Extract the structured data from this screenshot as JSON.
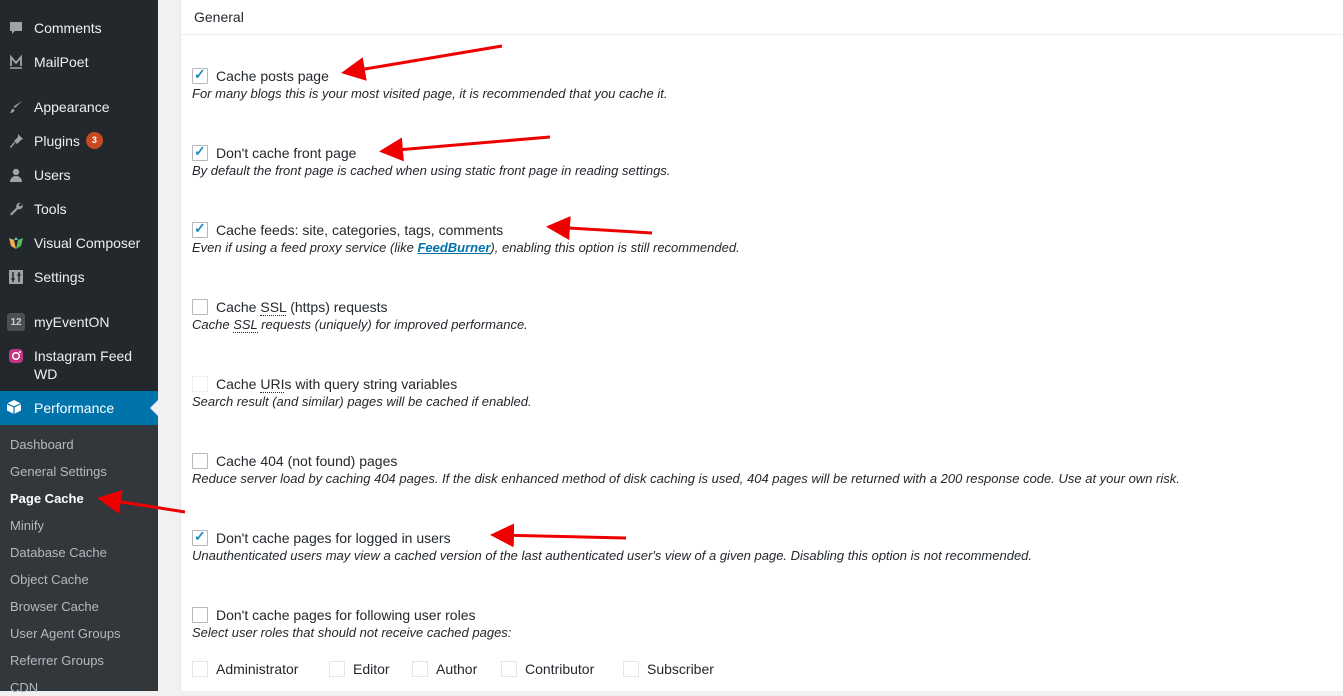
{
  "sidebar": {
    "items": [
      {
        "label": "Comments",
        "icon": "comment-icon"
      },
      {
        "label": "MailPoet",
        "icon": "mailpoet-icon"
      },
      {
        "label": "Appearance",
        "icon": "paintbrush-icon"
      },
      {
        "label": "Plugins",
        "icon": "plug-icon",
        "badge": "3"
      },
      {
        "label": "Users",
        "icon": "user-icon"
      },
      {
        "label": "Tools",
        "icon": "wrench-icon"
      },
      {
        "label": "Visual Composer",
        "icon": "visual-composer-icon"
      },
      {
        "label": "Settings",
        "icon": "settings-icon"
      },
      {
        "label": "myEventON",
        "icon": "calendar-icon",
        "icon_text": "12"
      },
      {
        "label": "Instagram Feed WD",
        "icon": "instagram-icon"
      }
    ],
    "active": {
      "label": "Performance",
      "icon": "performance-icon"
    },
    "submenu": [
      "Dashboard",
      "General Settings",
      "Page Cache",
      "Minify",
      "Database Cache",
      "Object Cache",
      "Browser Cache",
      "User Agent Groups",
      "Referrer Groups",
      "CDN"
    ],
    "current_submenu": "Page Cache"
  },
  "main": {
    "section_title": "General",
    "options": [
      {
        "label": "Cache posts page",
        "checked": true,
        "description": "For many blogs this is your most visited page, it is recommended that you cache it."
      },
      {
        "label": "Don't cache front page",
        "checked": true,
        "description": "By default the front page is cached when using static front page in reading settings."
      },
      {
        "label": "Cache feeds: site, categories, tags, comments",
        "checked": true,
        "description_pre": "Even if using a feed proxy service (like ",
        "description_link": "FeedBurner",
        "description_post": "), enabling this option is still recommended."
      },
      {
        "label_pre": "Cache ",
        "label_abbr": "SSL",
        "label_post": " (https) requests",
        "checked": false,
        "description_pre": "Cache ",
        "description_abbr": "SSL",
        "description_post": " requests (uniquely) for improved performance."
      },
      {
        "label_pre": "Cache ",
        "label_abbr": "URI",
        "label_post": "s with query string variables",
        "checked": false,
        "disabled": true,
        "description": "Search result (and similar) pages will be cached if enabled."
      },
      {
        "label": "Cache 404 (not found) pages",
        "checked": false,
        "description": "Reduce server load by caching 404 pages. If the disk enhanced method of disk caching is used, 404 pages will be returned with a 200 response code. Use at your own risk."
      },
      {
        "label": "Don't cache pages for logged in users",
        "checked": true,
        "description": "Unauthenticated users may view a cached version of the last authenticated user's view of a given page. Disabling this option is not recommended."
      },
      {
        "label": "Don't cache pages for following user roles",
        "checked": false,
        "description": "Select user roles that should not receive cached pages:"
      }
    ],
    "roles": [
      "Administrator",
      "Editor",
      "Author",
      "Contributor",
      "Subscriber"
    ]
  },
  "colors": {
    "sidebar_bg": "#23282d",
    "active_bg": "#0073aa",
    "submenu_bg": "#32373c",
    "arrow": "#ee0000",
    "check": "#1e8cbe"
  }
}
